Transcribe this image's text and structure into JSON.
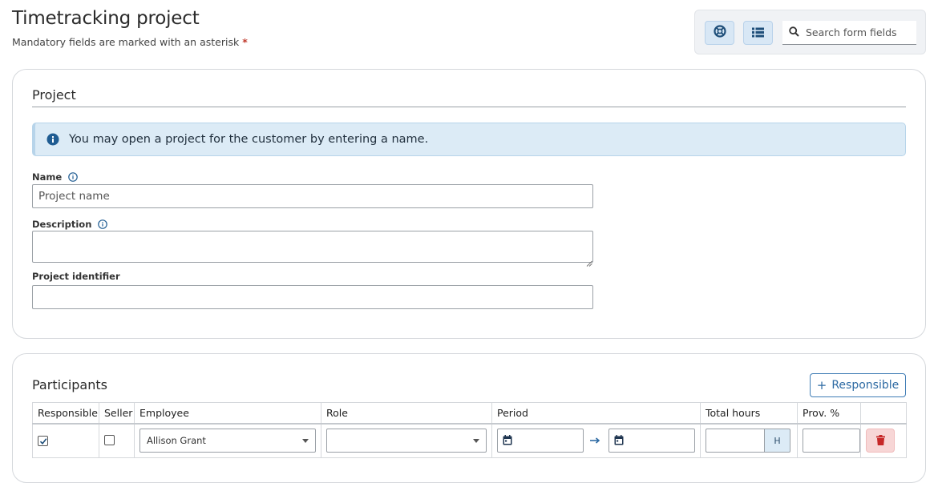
{
  "header": {
    "title": "Timetracking project",
    "subtitle": "Mandatory fields are marked with an asterisk",
    "asterisk": "*"
  },
  "toolbar": {
    "search_placeholder": "Search form fields",
    "icons": [
      "lifebuoy-icon",
      "list-icon",
      "search-icon"
    ]
  },
  "project": {
    "section_title": "Project",
    "info_text": "You may open a project for the customer by entering a name.",
    "fields": {
      "name_label": "Name",
      "name_placeholder": "Project name",
      "description_label": "Description",
      "identifier_label": "Project identifier"
    }
  },
  "participants": {
    "section_title": "Participants",
    "add_button_label": "Responsible",
    "columns": [
      "Responsible",
      "Seller",
      "Employee",
      "Role",
      "Period",
      "Total hours",
      "Prov. %",
      ""
    ],
    "rows": [
      {
        "responsible_checked": true,
        "seller_checked": false,
        "employee": "Allison Grant",
        "role": "",
        "period_start": "",
        "period_end": "",
        "total_hours": "",
        "hours_unit": "H",
        "prov_percent": ""
      }
    ]
  },
  "colors": {
    "accent": "#2d6aa3",
    "info_bg": "#dcebf6",
    "danger": "#c0392b",
    "danger_bg": "#f7d6d6"
  }
}
